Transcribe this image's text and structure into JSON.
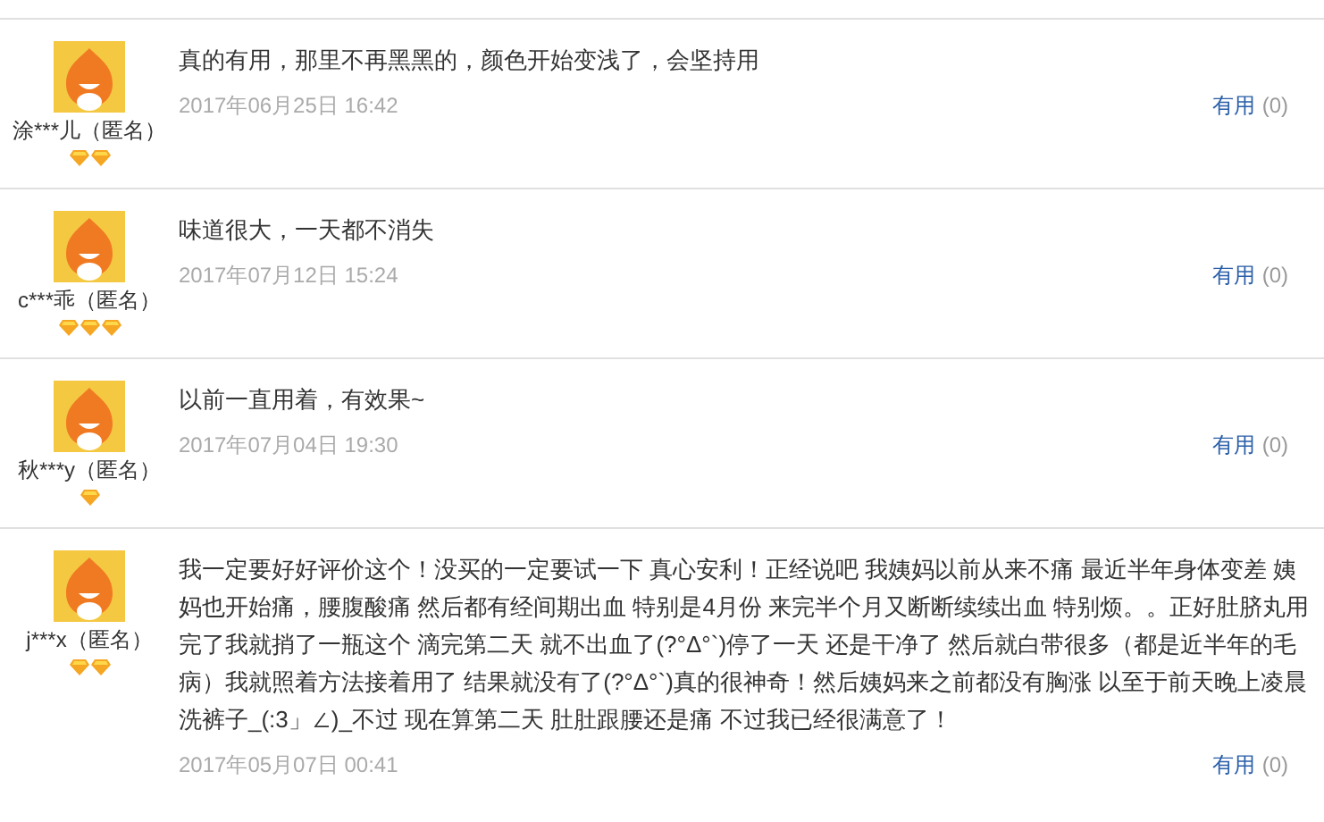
{
  "reviews": [
    {
      "user": "涂***儿（匿名）",
      "badges": [
        {
          "kind": "diamond"
        },
        {
          "kind": "diamond"
        }
      ],
      "text": "真的有用，那里不再黑黑的，颜色开始变浅了，会坚持用",
      "date": "2017年06月25日 16:42",
      "useful": "有用",
      "count": "(0)"
    },
    {
      "user": "c***乖（匿名）",
      "badges": [
        {
          "kind": "diamond"
        },
        {
          "kind": "diamond"
        },
        {
          "kind": "diamond"
        }
      ],
      "text": "味道很大，一天都不消失",
      "date": "2017年07月12日 15:24",
      "useful": "有用",
      "count": "(0)"
    },
    {
      "user": "秋***y（匿名）",
      "badges": [
        {
          "kind": "diamond"
        }
      ],
      "text": "以前一直用着，有效果~",
      "date": "2017年07月04日 19:30",
      "useful": "有用",
      "count": "(0)"
    },
    {
      "user": "j***x（匿名）",
      "badges": [
        {
          "kind": "diamond"
        },
        {
          "kind": "diamond"
        }
      ],
      "text": "我一定要好好评价这个！没买的一定要试一下 真心安利！正经说吧 我姨妈以前从来不痛 最近半年身体变差 姨妈也开始痛，腰腹酸痛 然后都有经间期出血 特别是4月份 来完半个月又断断续续出血 特别烦。。正好肚脐丸用完了我就捎了一瓶这个 滴完第二天 就不出血了(?°Δ°`)停了一天 还是干净了 然后就白带很多（都是近半年的毛病）我就照着方法接着用了 结果就没有了(?°Δ°`)真的很神奇！然后姨妈来之前都没有胸涨 以至于前天晚上凌晨洗裤子_(:3」∠)_不过 现在算第二天 肚肚跟腰还是痛 不过我已经很满意了！",
      "date": "2017年05月07日 00:41",
      "useful": "有用",
      "count": "(0)"
    }
  ]
}
